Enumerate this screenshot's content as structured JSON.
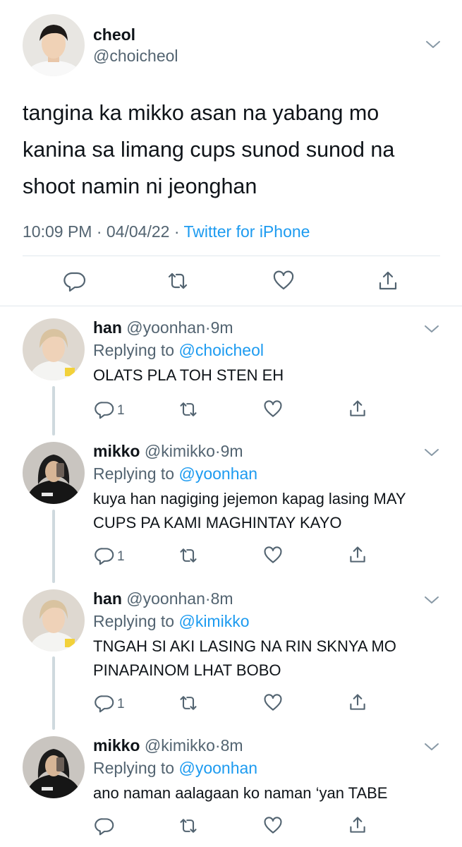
{
  "main_tweet": {
    "name": "cheol",
    "handle": "@choicheol",
    "text": "tangina ka mikko asan na yabang mo kanina sa limang cups sunod sunod na shoot namin ni jeonghan",
    "time": "10:09 PM",
    "date": "04/04/22",
    "source": "Twitter for iPhone",
    "meta_sep": " · "
  },
  "replies": [
    {
      "name": "han",
      "handle": "@yoonhan",
      "time": "9m",
      "replying_label": "Replying to ",
      "replying_to": "@choicheol",
      "text": "OLATS PLA TOH STEN EH",
      "reply_count": "1"
    },
    {
      "name": "mikko",
      "handle": "@kimikko",
      "time": "9m",
      "replying_label": "Replying to ",
      "replying_to": "@yoonhan",
      "text": "kuya han nagiging jejemon kapag lasing MAY CUPS PA KAMI MAGHINTAY KAYO",
      "reply_count": "1"
    },
    {
      "name": "han",
      "handle": "@yoonhan",
      "time": "8m",
      "replying_label": "Replying to ",
      "replying_to": "@kimikko",
      "text": "TNGAH SI AKI LASING NA RIN SKNYA MO PINAPAINOM LHAT BOBO",
      "reply_count": "1"
    },
    {
      "name": "mikko",
      "handle": "@kimikko",
      "time": "8m",
      "replying_label": "Replying to ",
      "replying_to": "@yoonhan",
      "text": "ano naman aalagaan ko naman ‘yan TABE",
      "reply_count": ""
    }
  ],
  "colors": {
    "text": "#0f1419",
    "secondary": "#536471",
    "link": "#1d9bf0",
    "divider": "#e1e8ed",
    "thread_line": "#cfd9de"
  },
  "icons": [
    "chevron-down-icon",
    "reply-icon",
    "retweet-icon",
    "like-icon",
    "share-icon"
  ]
}
